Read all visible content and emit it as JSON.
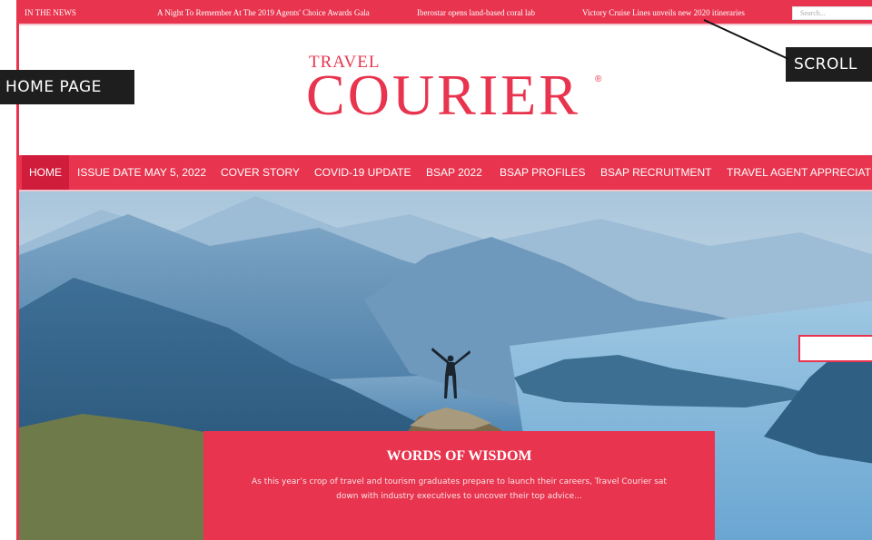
{
  "ticker": {
    "label": "IN THE NEWS",
    "items": [
      "A Night To Remember At The 2019 Agents' Choice Awards Gala",
      "Iberostar opens land-based coral lab",
      "Victory Cruise Lines unveils new 2020 itineraries"
    ],
    "search_placeholder": "Search..."
  },
  "logo": {
    "top": "TRAVEL",
    "main": "COURIER",
    "mark": "®"
  },
  "nav": {
    "items": [
      "HOME",
      "ISSUE DATE MAY 5, 2022",
      "COVER STORY",
      "COVID-19 UPDATE",
      "BSAP 2022",
      "BSAP PROFILES",
      "BSAP RECRUITMENT",
      "TRAVEL AGENT APPRECIATIO"
    ]
  },
  "feature": {
    "title": "WORDS OF WISDOM",
    "excerpt": "As this year’s crop of travel and tourism graduates prepare to launch their careers, Travel Courier sat down with industry executives to uncover their top advice..."
  },
  "annotations": {
    "home_page": "HOME PAGE",
    "scroll": "SCROLL"
  },
  "colors": {
    "brand": "#e8344e",
    "active_nav": "#d11d3c",
    "annotation_bg": "#1e1e1e"
  }
}
